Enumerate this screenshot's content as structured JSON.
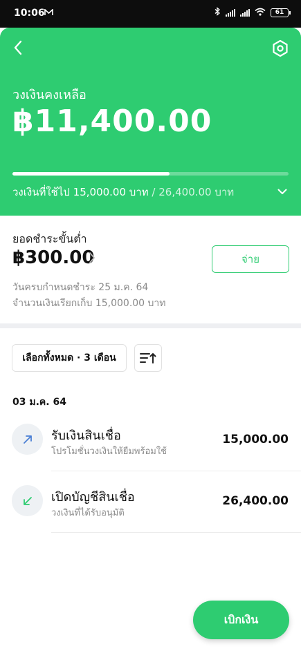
{
  "status_bar": {
    "time": "10:06",
    "battery": "61"
  },
  "header": {
    "remaining_label": "วงเงินคงเหลือ",
    "remaining_amount": "฿11,400.00",
    "used_progress": 0.568,
    "used_label": "วงเงินที่ใช้ไป 15,000.00 บาท",
    "separator": "/",
    "total_label": "26,400.00 บาท"
  },
  "payment": {
    "min_label": "ยอดชำระขั้นต่ำ",
    "min_amount": "฿300.00",
    "pay_button": "จ่าย",
    "due_date": "วันครบกำหนดชำระ 25 ม.ค. 64",
    "billed_amount": "จำนวนเงินเรียกเก็บ 15,000.00 บาท"
  },
  "filter": {
    "label": "เลือกทั้งหมด · 3 เดือน"
  },
  "transactions": {
    "date": "03 ม.ค. 64",
    "items": [
      {
        "title": "รับเงินสินเชื่อ",
        "subtitle": "โปรโมชั่นวงเงินให้ยืมพร้อมใช้",
        "amount": "15,000.00",
        "icon": "arrow-up-right-icon",
        "icon_color": "#4a7fd4"
      },
      {
        "title": "เปิดบัญชีสินเชื่อ",
        "subtitle": "วงเงินที่ได้รับอนุมัติ",
        "amount": "26,400.00",
        "icon": "arrow-down-left-icon",
        "icon_color": "#2ecc71"
      }
    ]
  },
  "fab": {
    "label": "เบิกเงิน"
  },
  "colors": {
    "brand": "#2ecc71",
    "status_bar": "#0d0d0d"
  }
}
